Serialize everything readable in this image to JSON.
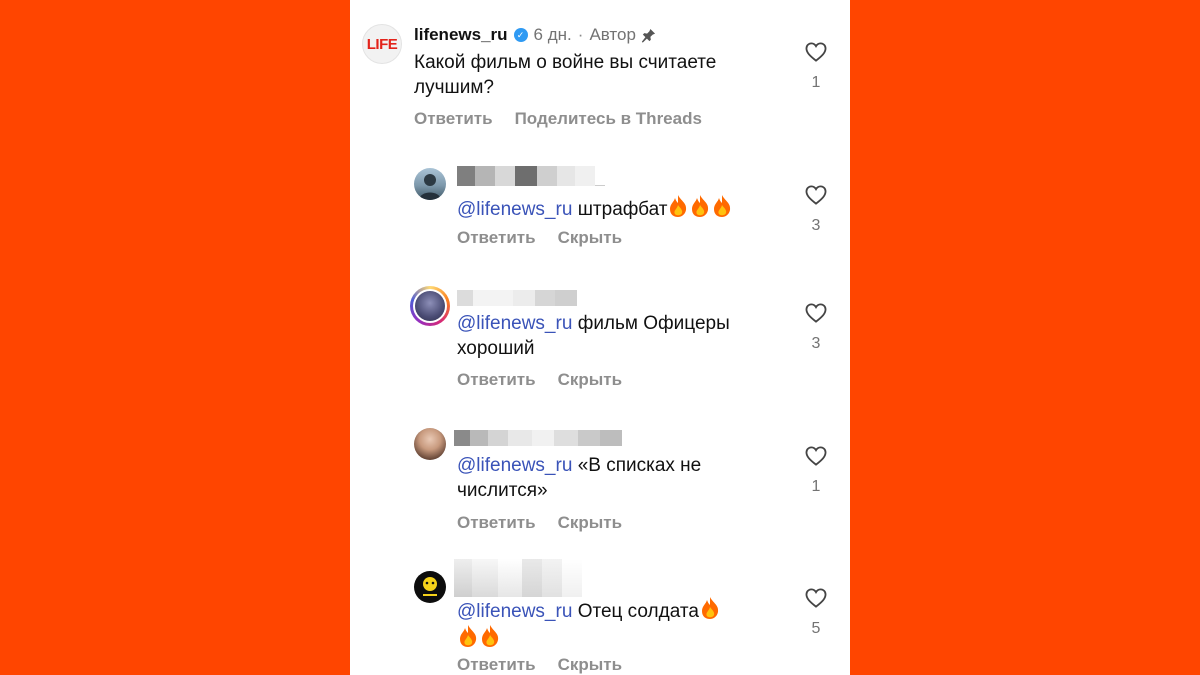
{
  "post": {
    "username": "lifenews_ru",
    "logo_text": "LIFE",
    "time": "6 дн.",
    "separator": "·",
    "author_label": "Автор",
    "text": "Какой фильм о войне вы считаете лучшим?",
    "reply_label": "Ответить",
    "share_label": "Поделитесь в Threads",
    "likes": "1"
  },
  "replies": [
    {
      "mention": "@lifenews_ru",
      "text": "штрафбат",
      "fire_count": 3,
      "likes": "3",
      "reply_label": "Ответить",
      "hide_label": "Скрыть"
    },
    {
      "mention": "@lifenews_ru",
      "text": "фильм Офицеры хороший",
      "fire_count": 0,
      "likes": "3",
      "reply_label": "Ответить",
      "hide_label": "Скрыть"
    },
    {
      "mention": "@lifenews_ru",
      "text": "«В списках не числится»",
      "fire_count": 0,
      "likes": "1",
      "reply_label": "Ответить",
      "hide_label": "Скрыть"
    },
    {
      "mention": "@lifenews_ru",
      "text": "Отец солдата",
      "fire_count": 3,
      "likes": "5",
      "reply_label": "Ответить",
      "hide_label": "Скрыть"
    }
  ],
  "colors": {
    "background": "#ff4500",
    "mention": "#3a53b8",
    "verified": "#2f9af3",
    "logo": "#e3231b"
  },
  "icons": [
    "heart-icon",
    "verified-icon",
    "pin-icon",
    "fire-emoji"
  ]
}
